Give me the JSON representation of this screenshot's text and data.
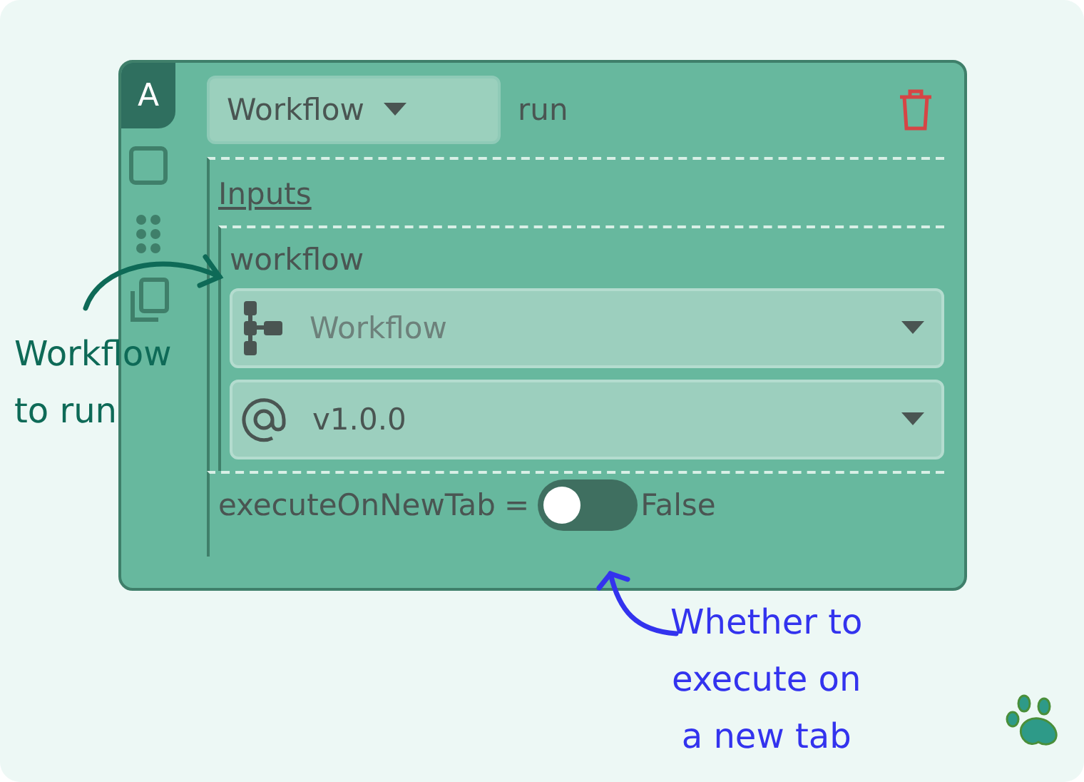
{
  "block": {
    "badge": "A",
    "type_dropdown": {
      "value": "Workflow"
    },
    "name": "run",
    "inputs_heading": "Inputs",
    "inputs": [
      {
        "kind": "selector",
        "label": "workflow",
        "fields": [
          {
            "kind": "workflow",
            "placeholder": "Workflow"
          },
          {
            "kind": "version",
            "value": "v1.0.0"
          }
        ]
      },
      {
        "kind": "toggle",
        "label": "executeOnNewTab",
        "operator": "=",
        "on": false,
        "value_text": "False"
      }
    ]
  },
  "annotations": [
    {
      "text": "Workflow\nto run",
      "color": "#0e6a57"
    },
    {
      "text": "Whether to\nexecute on\na new tab",
      "color": "#3333ee"
    }
  ]
}
